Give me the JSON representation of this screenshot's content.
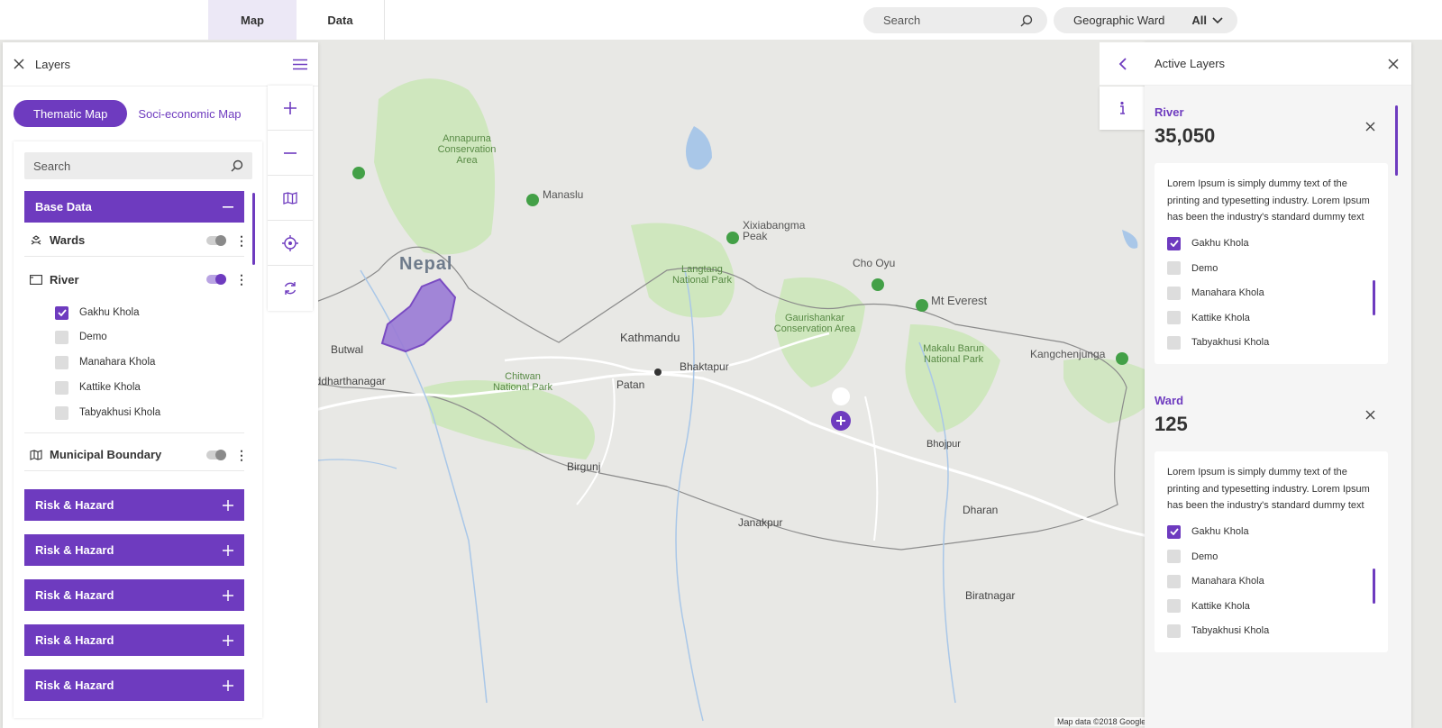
{
  "topbar": {
    "tabs": [
      {
        "label": "Map",
        "active": true
      },
      {
        "label": "Data",
        "active": false
      }
    ],
    "search_placeholder": "Search",
    "ward_filter": {
      "label": "Geographic Ward",
      "value": "All"
    }
  },
  "left_panel": {
    "title": "Layers",
    "map_types": [
      {
        "label": "Thematic Map",
        "active": true
      },
      {
        "label": "Soci-economic Map",
        "active": false
      }
    ],
    "search_placeholder": "Search",
    "base_data": {
      "label": "Base Data",
      "layers": [
        {
          "name": "Wards",
          "icon": "wards-icon",
          "enabled": false
        },
        {
          "name": "River",
          "icon": "river-icon",
          "enabled": true,
          "items": [
            {
              "label": "Gakhu Khola",
              "checked": true
            },
            {
              "label": "Demo",
              "checked": false
            },
            {
              "label": "Manahara Khola",
              "checked": false
            },
            {
              "label": "Kattike Khola",
              "checked": false
            },
            {
              "label": "Tabyakhusi Khola",
              "checked": false
            }
          ]
        },
        {
          "name": "Municipal Boundary",
          "icon": "map-icon",
          "enabled": false
        }
      ]
    },
    "groups": [
      "Risk & Hazard",
      "Risk & Hazard",
      "Risk & Hazard",
      "Risk & Hazard",
      "Risk & Hazard"
    ]
  },
  "map_tools": [
    "zoom-in-icon",
    "zoom-out-icon",
    "map-icon",
    "locate-icon",
    "refresh-icon"
  ],
  "right_panel": {
    "title": "Active Layers",
    "sections": [
      {
        "title": "River",
        "value": "35,050",
        "description": "Lorem Ipsum is simply dummy text of the printing and typesetting industry. Lorem Ipsum has been the industry's standard dummy text",
        "items": [
          {
            "label": "Gakhu Khola",
            "checked": true
          },
          {
            "label": "Demo",
            "checked": false
          },
          {
            "label": "Manahara Khola",
            "checked": false
          },
          {
            "label": "Kattike Khola",
            "checked": false
          },
          {
            "label": "Tabyakhusi Khola",
            "checked": false
          }
        ]
      },
      {
        "title": "Ward",
        "value": "125",
        "description": "Lorem Ipsum is simply dummy text of the printing and typesetting industry. Lorem Ipsum has been the industry's standard dummy text",
        "items": [
          {
            "label": "Gakhu Khola",
            "checked": true
          },
          {
            "label": "Demo",
            "checked": false
          },
          {
            "label": "Manahara Khola",
            "checked": false
          },
          {
            "label": "Kattike Khola",
            "checked": false
          },
          {
            "label": "Tabyakhusi Khola",
            "checked": false
          }
        ]
      }
    ]
  },
  "map": {
    "country_label": "Nepal",
    "places": [
      "Kathmandu",
      "Patan",
      "Bhaktapur",
      "Biratnagar",
      "Janakpur",
      "Birgunj",
      "Butwal",
      "Siddharthanagar",
      "Dharan",
      "Bhojpur"
    ],
    "peaks": [
      "Manaslu",
      "Xixiabangma Peak",
      "Cho Oyu",
      "Mt Everest",
      "Kangchenjunga"
    ],
    "parks": [
      "Annapurna Conservation Area",
      "Langtang National Park",
      "Chitwan National Park",
      "Gaurishankar Conservation Area",
      "Makalu Barun National Park"
    ],
    "credit": "Map data ©2018 Google"
  },
  "colors": {
    "accent": "#6e3bbf",
    "map_bg": "#e8e8e5",
    "park_green": "#c8e6b4"
  }
}
